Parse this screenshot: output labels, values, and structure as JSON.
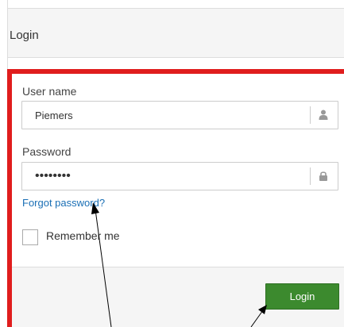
{
  "panel": {
    "title": "Login"
  },
  "form": {
    "username_label": "User name",
    "username_value": "Piemers",
    "password_label": "Password",
    "password_value": "••••••••",
    "forgot_link": "Forgot password?",
    "remember_label": "Remember me",
    "remember_checked": false,
    "login_button": "Login"
  },
  "colors": {
    "highlight_frame": "#e01d1d",
    "login_button": "#3c8a2e",
    "link": "#1a6fb5"
  },
  "icons": {
    "username_addon": "user-icon",
    "password_addon": "lock-icon"
  }
}
